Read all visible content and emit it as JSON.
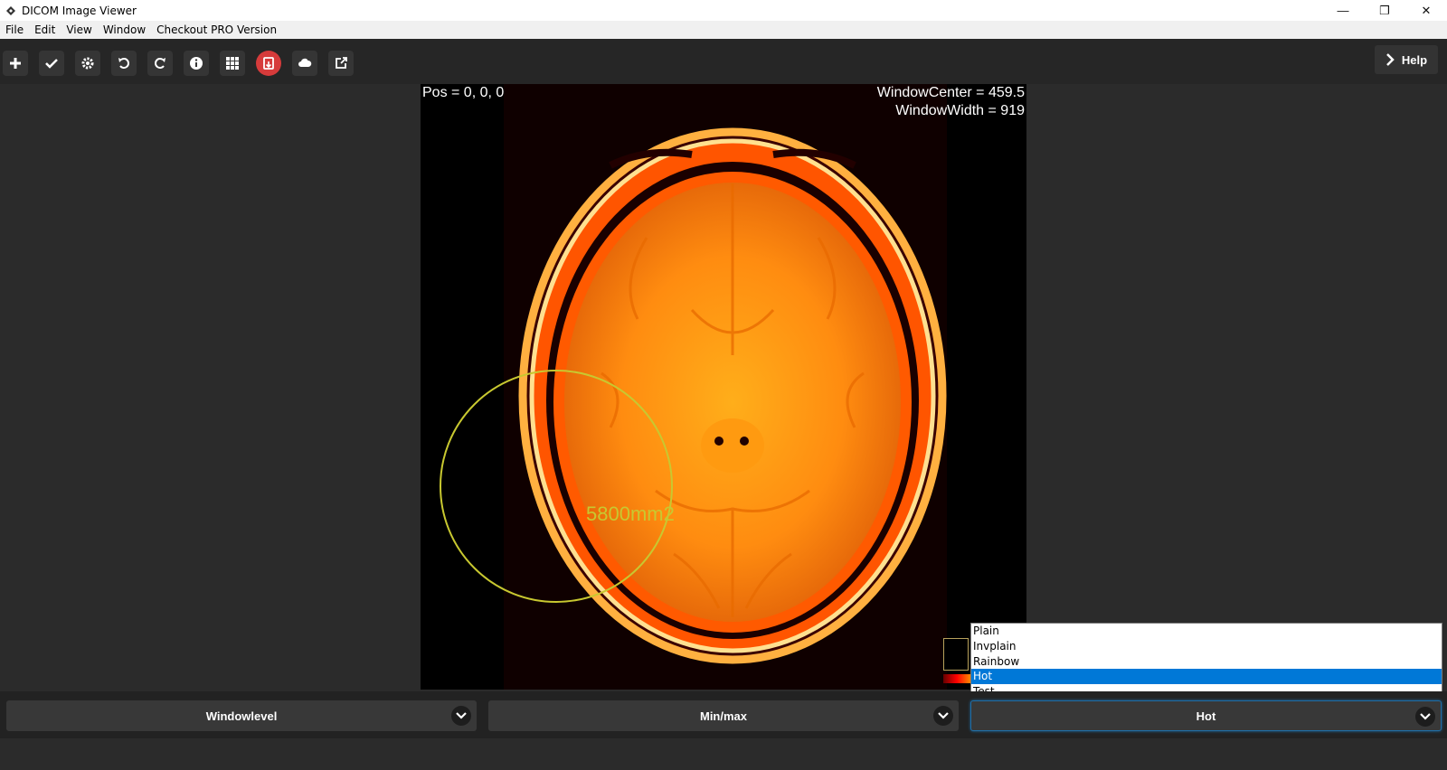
{
  "window": {
    "title": "DICOM Image Viewer",
    "minimize_glyph": "—",
    "restore_glyph": "❐",
    "close_glyph": "✕"
  },
  "menu": {
    "items": [
      "File",
      "Edit",
      "View",
      "Window",
      "Checkout PRO Version"
    ]
  },
  "toolbar": {
    "buttons": [
      "plus-icon",
      "check-icon",
      "gear-icon",
      "undo-icon",
      "redo-icon",
      "info-icon",
      "grid-icon",
      "save-icon",
      "cloud-icon",
      "share-icon"
    ],
    "help_label": "Help"
  },
  "viewer": {
    "pos_text": "Pos = 0, 0, 0",
    "window_center_text": "WindowCenter = 459.5",
    "window_width_text": "WindowWidth = 919",
    "roi_area_text": "5800mm2",
    "colormap_preview": "hot"
  },
  "colormap_dropdown": {
    "options": [
      "Plain",
      "Invplain",
      "Rainbow",
      "Hot",
      "Test"
    ],
    "selected": "Hot"
  },
  "bottom_selects": {
    "windowlevel_label": "Windowlevel",
    "minmax_label": "Min/max",
    "colormap_label": "Hot"
  },
  "colors": {
    "accent": "#0078d7",
    "toolbar_bg": "#262626",
    "save_button": "#d63b3b",
    "roi_circle": "#c8c830"
  }
}
